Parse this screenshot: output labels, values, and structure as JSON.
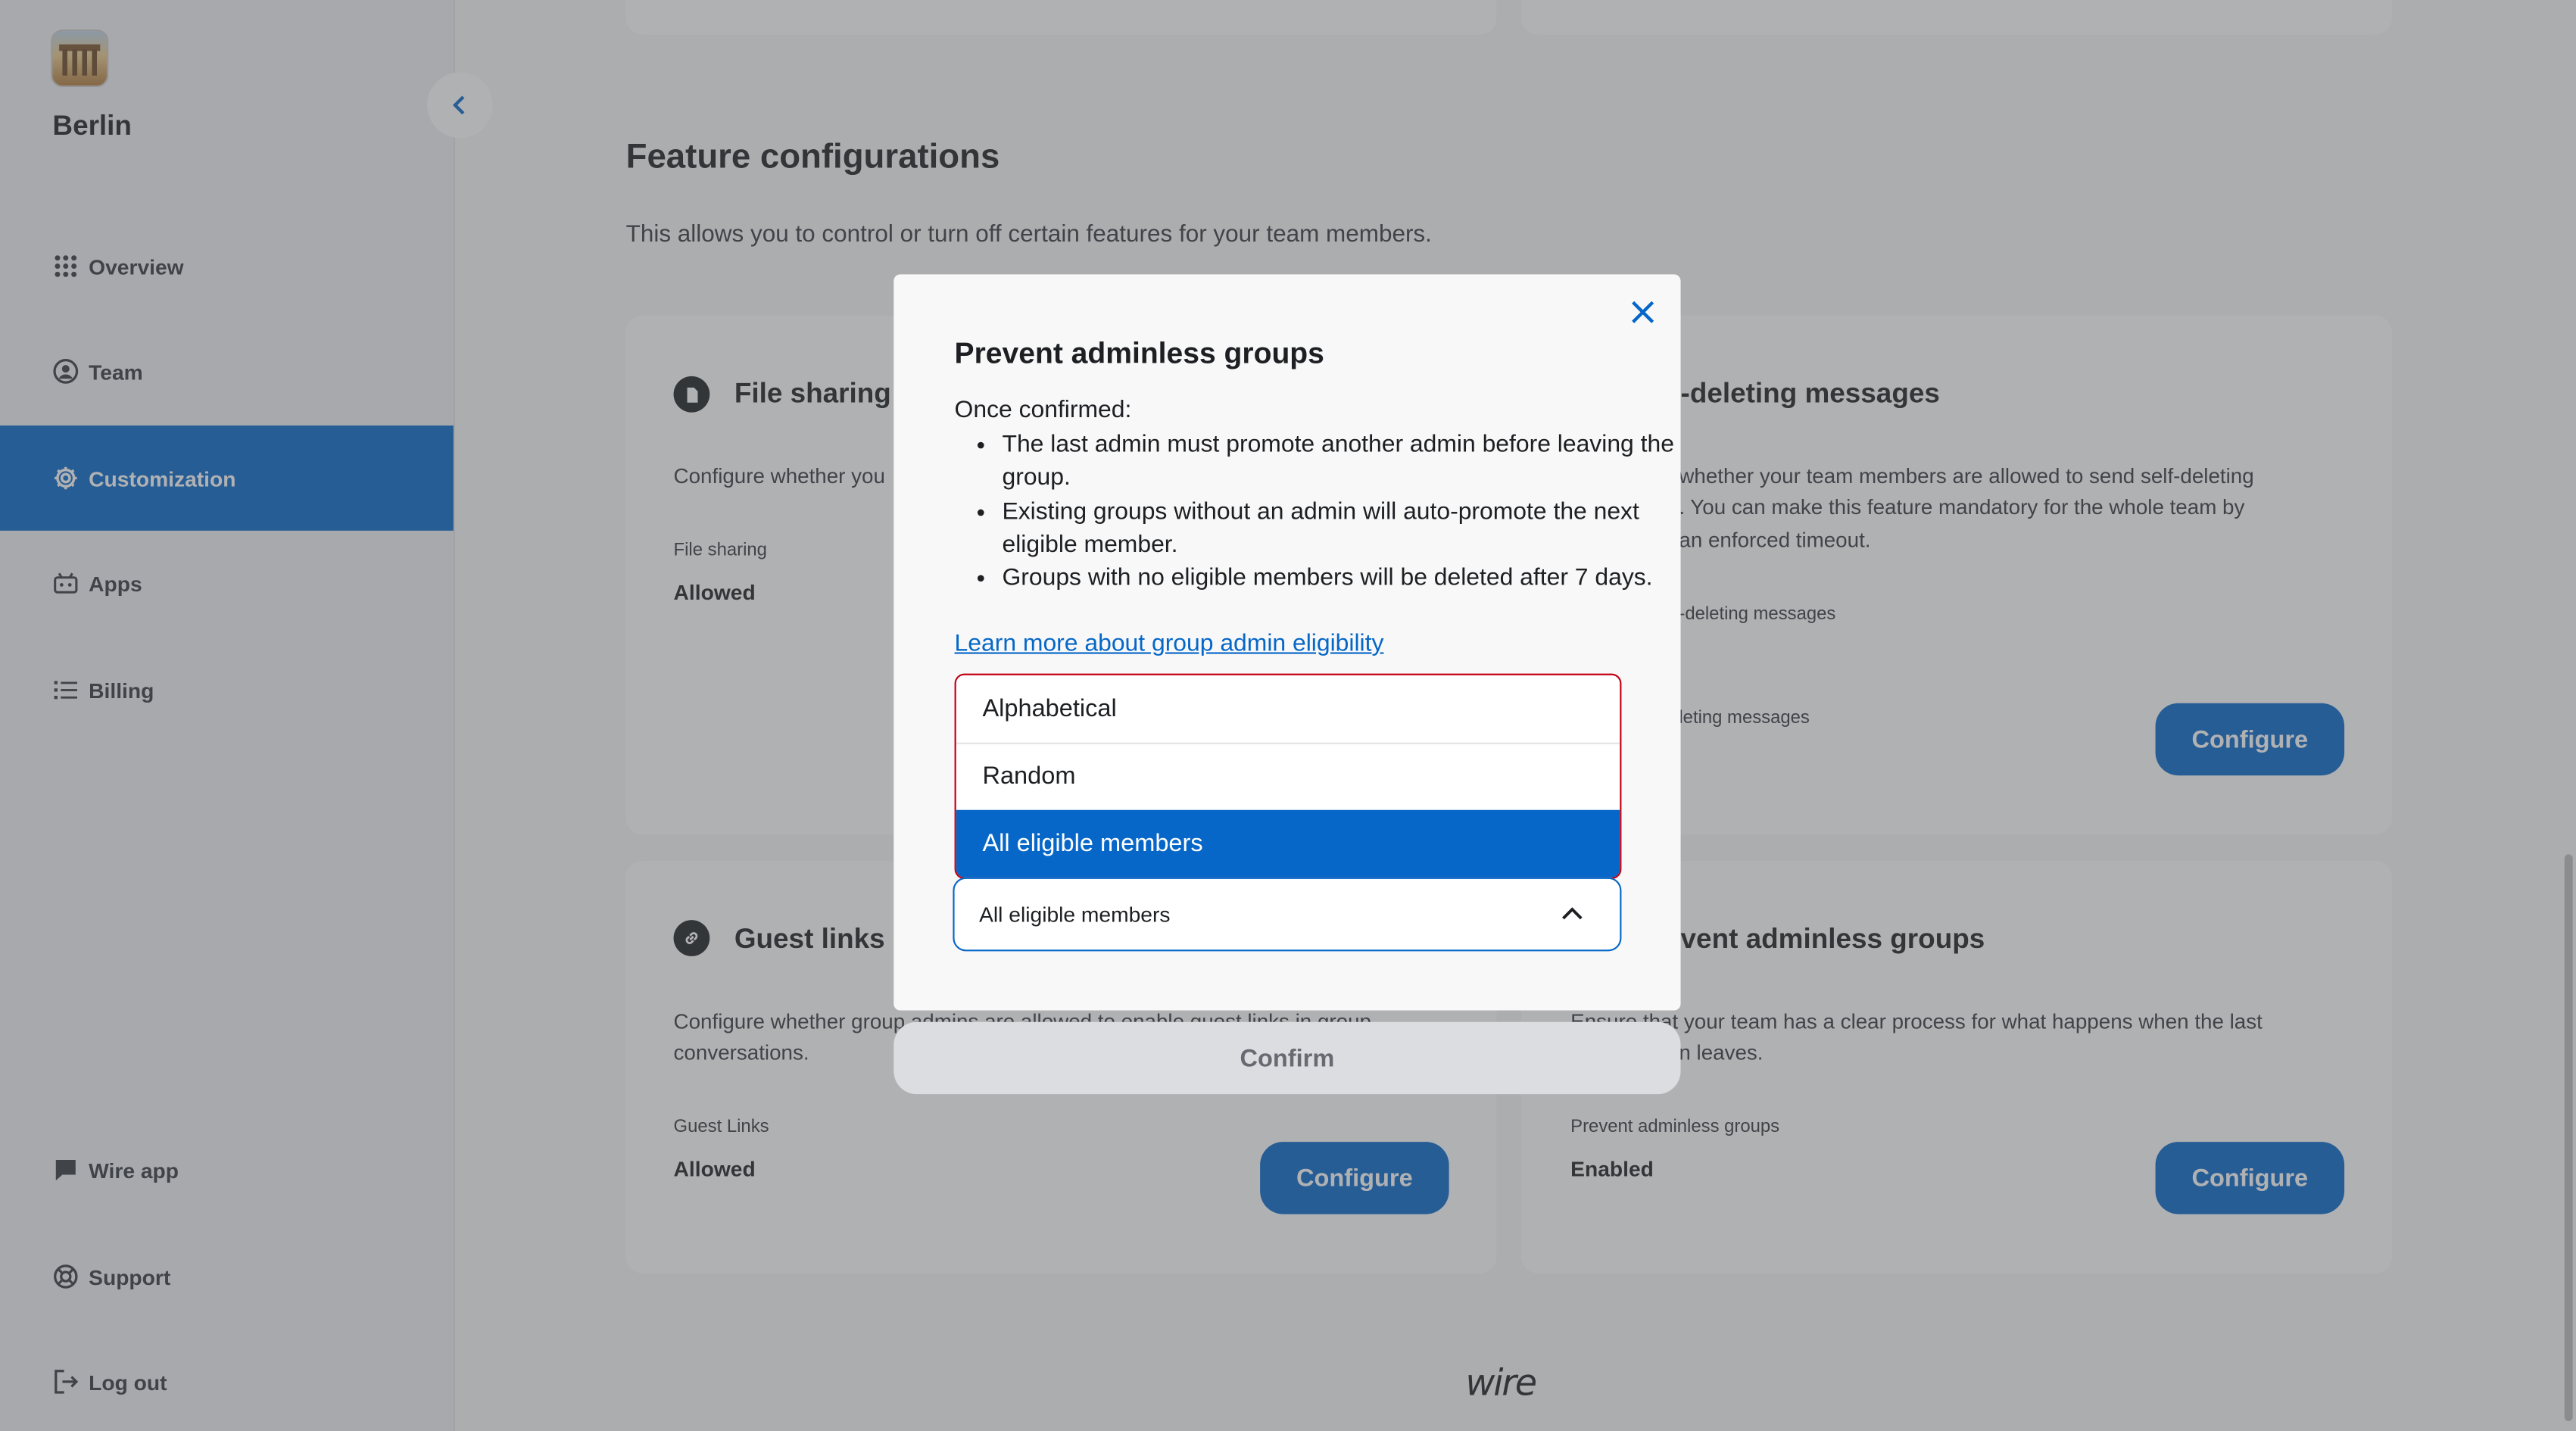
{
  "sidebar": {
    "team_name": "Berlin",
    "items": [
      {
        "label": "Overview",
        "icon": "grid-icon"
      },
      {
        "label": "Team",
        "icon": "user-circle-icon"
      },
      {
        "label": "Customization",
        "icon": "gear-icon",
        "active": true
      },
      {
        "label": "Apps",
        "icon": "robot-icon"
      },
      {
        "label": "Billing",
        "icon": "list-icon"
      },
      {
        "label": "Wire app",
        "icon": "chat-icon"
      },
      {
        "label": "Support",
        "icon": "lifebuoy-icon"
      },
      {
        "label": "Log out",
        "icon": "logout-icon"
      }
    ]
  },
  "main": {
    "section_title": "Feature configurations",
    "section_desc": "This allows you to control or turn off certain features for your team members.",
    "cards": {
      "file_sharing": {
        "title": "File sharing",
        "desc": "Configure whether you",
        "sub": "File sharing",
        "value": "Allowed"
      },
      "self_deleting": {
        "title": "-deleting messages",
        "desc_lines": [
          "whether your team members are allowed to send self-deleting",
          ". You can make this feature mandatory for the whole team by",
          "an enforced timeout."
        ],
        "sub1": "-deleting messages",
        "sub2": "leting messages",
        "button": "Configure"
      },
      "guest_links": {
        "title": "Guest links",
        "desc_lines": [
          "Configure whether group admins are allowed to enable guest links in group",
          "conversations."
        ],
        "sub": "Guest Links",
        "value": "Allowed",
        "button": "Configure"
      },
      "adminless": {
        "title": "vent adminless groups",
        "desc_lines": [
          "Ensure that your team has a clear process for what happens when the last",
          "n leaves."
        ],
        "sub": "Prevent adminless groups",
        "value": "Enabled",
        "button": "Configure"
      }
    },
    "footer_logo": "wire"
  },
  "modal": {
    "title": "Prevent adminless groups",
    "intro": "Once confirmed:",
    "bullets": [
      "The last admin must promote another admin before leaving the group.",
      "Existing groups without an admin will auto-promote the next eligible member.",
      "Groups with no eligible members will be deleted after 7 days."
    ],
    "link": "Learn more about group admin eligibility",
    "options": [
      "Alphabetical",
      "Random",
      "All eligible members"
    ],
    "selected": "All eligible members",
    "confirm": "Confirm"
  },
  "colors": {
    "accent": "#0667c8",
    "error_outline": "#c20013"
  }
}
